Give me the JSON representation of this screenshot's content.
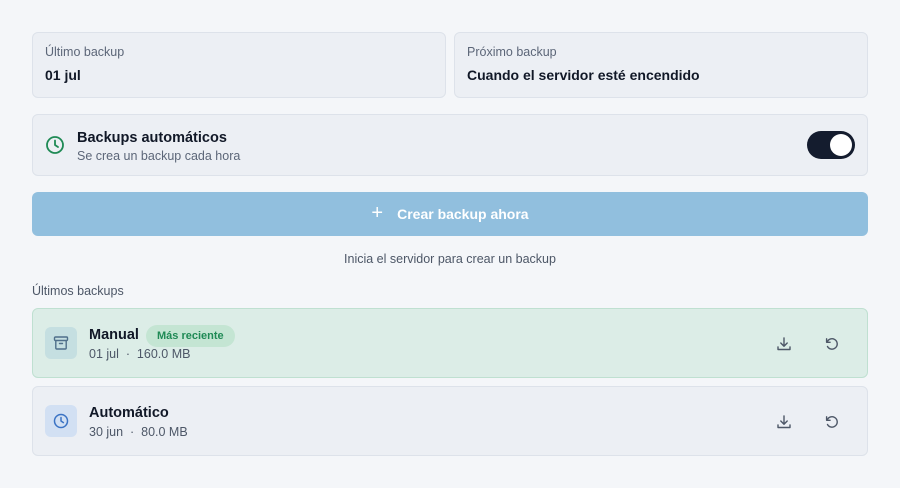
{
  "last_backup": {
    "label": "Último backup",
    "value": "01 jul"
  },
  "next_backup": {
    "label": "Próximo backup",
    "value": "Cuando el servidor esté encendido"
  },
  "auto_backups": {
    "title": "Backups automáticos",
    "subtitle": "Se crea un backup cada hora",
    "enabled": true,
    "icon": "clock-icon"
  },
  "create_button": {
    "label": "Crear backup ahora",
    "icon": "plus-icon",
    "disabled": true
  },
  "hint": "Inicia el servidor para crear un backup",
  "section_label": "Últimos backups",
  "backups": [
    {
      "name": "Manual",
      "badge": "Más reciente",
      "meta": "01 jul  ·  160.0 MB",
      "icon": "archive-icon"
    },
    {
      "name": "Automático",
      "meta": "30 jun  ·  80.0 MB",
      "icon": "clock-icon"
    }
  ],
  "colors": {
    "accent_green": "#1f8a55",
    "button_disabled": "#91bfde",
    "toggle_on": "#141c2e",
    "recent_row_bg": "#dcede7"
  }
}
